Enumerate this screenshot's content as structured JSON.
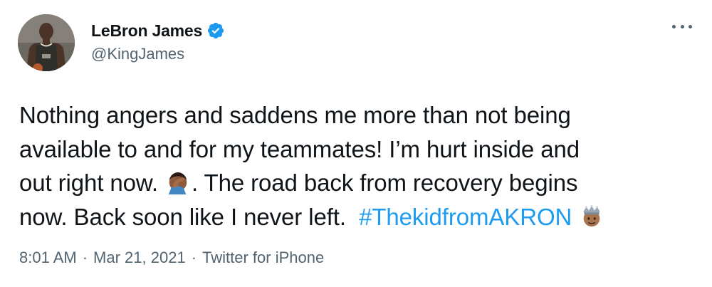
{
  "author": {
    "display_name": "LeBron James",
    "handle": "@KingJames",
    "verified_icon": "verified-badge-icon"
  },
  "tweet": {
    "line1": "Nothing angers and saddens me more than not being",
    "line2": "available to and for my teammates! I’m hurt inside and",
    "line3_before": "out right now.",
    "line3_emoji": "face-palm-emoji",
    "line3_after": ". The road back from recovery begins",
    "line4_before": "now. Back soon like I never left.",
    "hashtag": "#ThekidfromAKRON",
    "line4_emoji": "crowned-face-emoji"
  },
  "meta": {
    "time": "8:01 AM",
    "date": "Mar 21, 2021",
    "source": "Twitter for iPhone",
    "separator": "·"
  },
  "colors": {
    "accent": "#1d9bf0",
    "text": "#0f1419",
    "secondary": "#536471"
  },
  "more_icon": "more-dots-icon"
}
